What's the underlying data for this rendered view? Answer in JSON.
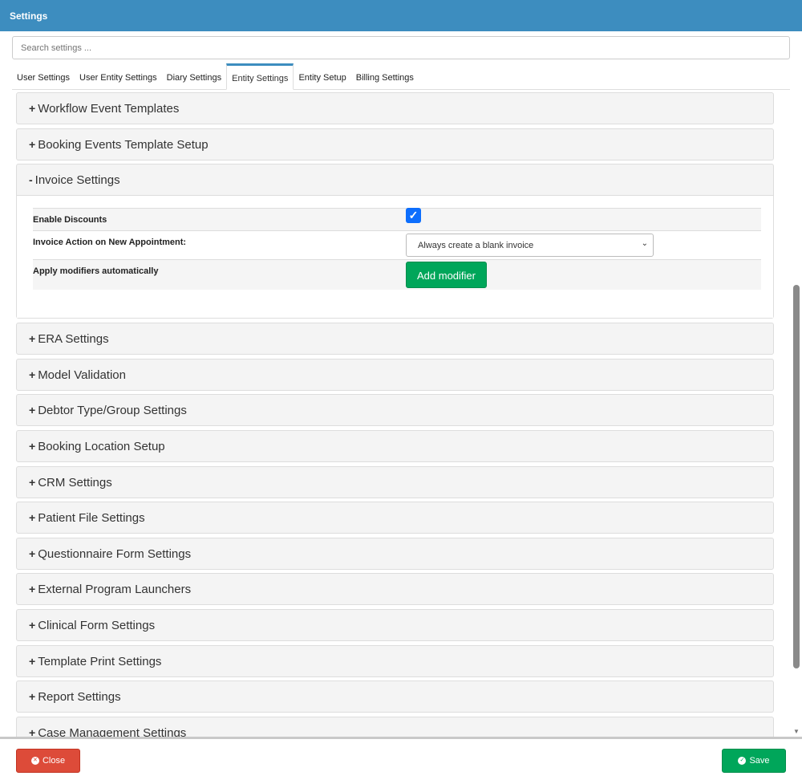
{
  "header": {
    "title": "Settings"
  },
  "search": {
    "placeholder": "Search settings ..."
  },
  "tabs": [
    "User Settings",
    "User Entity Settings",
    "Diary Settings",
    "Entity Settings",
    "Entity Setup",
    "Billing Settings"
  ],
  "panels": [
    "Workflow Event Templates",
    "Booking Events Template Setup",
    "Invoice Settings",
    "ERA Settings",
    "Model Validation",
    "Debtor Type/Group Settings",
    "Booking Location Setup",
    "CRM Settings",
    "Patient File Settings",
    "Questionnaire Form Settings",
    "External Program Launchers",
    "Clinical Form Settings",
    "Template Print Settings",
    "Report Settings",
    "Case Management Settings"
  ],
  "invoice": {
    "enable_discounts": "Enable Discounts",
    "enable_discounts_checked": true,
    "action_label": "Invoice Action on New Appointment:",
    "action_value": "Always create a blank invoice",
    "modifiers_label": "Apply modifiers automatically",
    "add_modifier": "Add modifier"
  },
  "footer": {
    "close": "Close",
    "save": "Save"
  }
}
